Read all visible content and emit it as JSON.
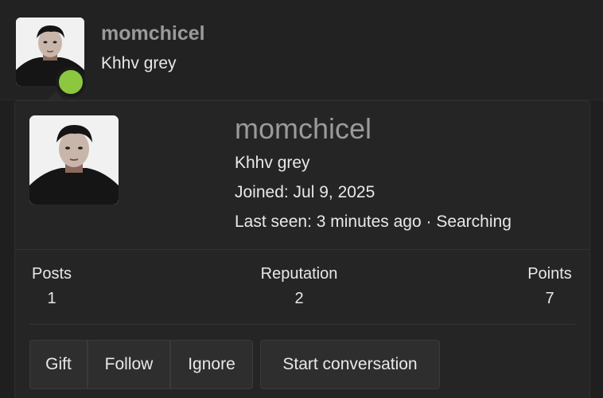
{
  "header": {
    "username": "momchicel",
    "user_title": "Khhv grey",
    "online_status": "online"
  },
  "card": {
    "username": "momchicel",
    "user_title": "Khhv grey",
    "joined": "Joined: Jul 9, 2025",
    "last_seen": "Last seen: 3 minutes ago · Searching"
  },
  "stats": [
    {
      "label": "Posts",
      "value": "1"
    },
    {
      "label": "Reputation",
      "value": "2"
    },
    {
      "label": "Points",
      "value": "7"
    }
  ],
  "actions": {
    "gift": "Gift",
    "follow": "Follow",
    "ignore": "Ignore",
    "start_conversation": "Start conversation"
  },
  "colors": {
    "online": "#8dc63f",
    "background": "#1f1f1f",
    "username": "#9a9a9a"
  }
}
